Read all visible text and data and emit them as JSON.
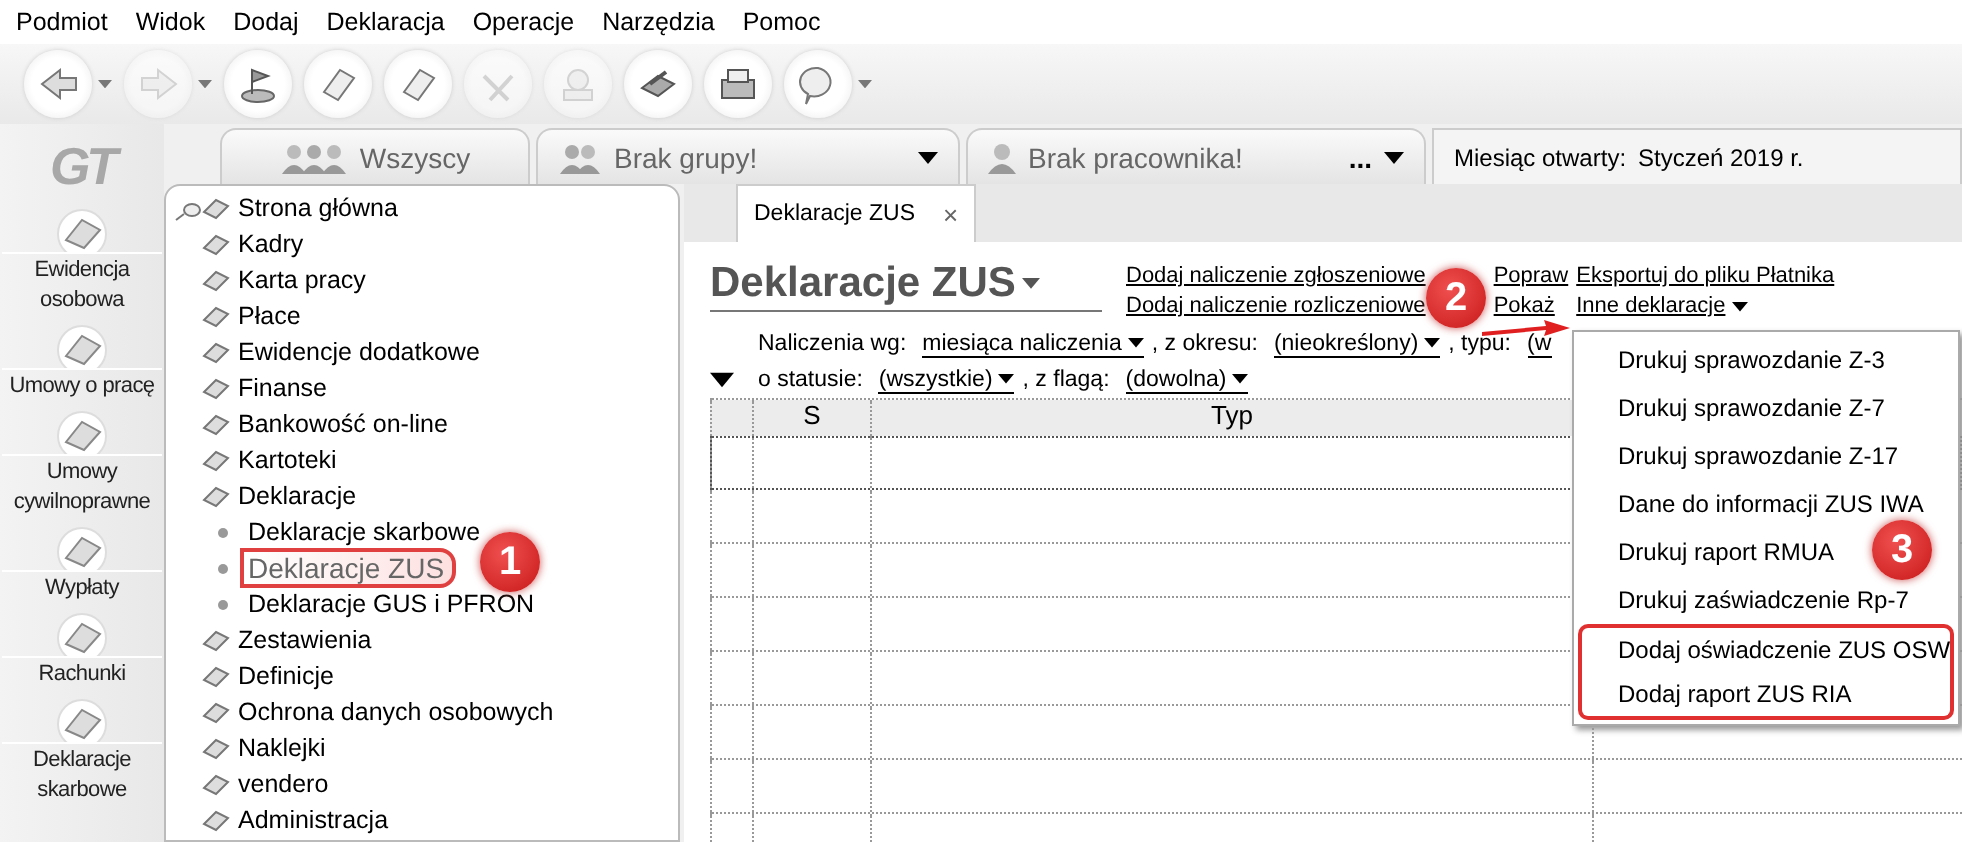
{
  "menu_bar": [
    "Podmiot",
    "Widok",
    "Dodaj",
    "Deklaracja",
    "Operacje",
    "Narzędzia",
    "Pomoc"
  ],
  "toolbar": [
    {
      "dropdown": true,
      "disabled": false
    },
    {
      "dropdown": true,
      "disabled": true
    },
    {
      "dropdown": false,
      "disabled": false
    },
    {
      "dropdown": false,
      "disabled": false
    },
    {
      "dropdown": false,
      "disabled": false
    },
    {
      "dropdown": false,
      "disabled": true
    },
    {
      "dropdown": false,
      "disabled": true
    },
    {
      "dropdown": false,
      "disabled": false
    },
    {
      "dropdown": false,
      "disabled": false
    },
    {
      "dropdown": true,
      "disabled": false
    }
  ],
  "logo": "GT",
  "nav": [
    {
      "label": "Ewidencja osobowa"
    },
    {
      "label": "Umowy o pracę"
    },
    {
      "label": "Umowy cywilnoprawne"
    },
    {
      "label": "Wypłaty"
    },
    {
      "label": "Rachunki"
    },
    {
      "label": "Deklaracje skarbowe"
    }
  ],
  "selectors": [
    {
      "label": "Wszyscy",
      "kind": "tab"
    },
    {
      "label": "Brak grupy!",
      "kind": "dropdown"
    },
    {
      "label": "Brak pracownika!",
      "kind": "employee",
      "more": "..."
    },
    {
      "label": "Miesiąc otwarty:",
      "value": "Styczeń 2019 r.",
      "kind": "info"
    }
  ],
  "tree": [
    {
      "label": "Strona główna",
      "selected": false
    },
    {
      "label": "Kadry",
      "selected": false
    },
    {
      "label": "Karta pracy",
      "selected": false
    },
    {
      "label": "Płace",
      "selected": false
    },
    {
      "label": "Ewidencje dodatkowe",
      "selected": false
    },
    {
      "label": "Finanse",
      "selected": false
    },
    {
      "label": "Bankowość on-line",
      "selected": false
    },
    {
      "label": "Kartoteki",
      "selected": false
    },
    {
      "label": "Deklaracje",
      "selected": false,
      "children": [
        {
          "label": "Deklaracje skarbowe",
          "selected": false
        },
        {
          "label": "Deklaracje ZUS",
          "selected": true
        },
        {
          "label": "Deklaracje GUS i PFRON",
          "selected": false
        }
      ]
    },
    {
      "label": "Zestawienia",
      "selected": false
    },
    {
      "label": "Definicje",
      "selected": false
    },
    {
      "label": "Ochrona danych osobowych",
      "selected": false
    },
    {
      "label": "Naklejki",
      "selected": false
    },
    {
      "label": "vendero",
      "selected": false
    },
    {
      "label": "Administracja",
      "selected": false
    }
  ],
  "document_tab": {
    "label": "Deklaracje ZUS",
    "close": "×"
  },
  "page": {
    "title": "Deklaracje ZUS",
    "links": [
      [
        "Dodaj naliczenie zgłoszeniowe",
        "Dodaj naliczenie rozliczeniowe"
      ],
      [
        "Popraw",
        "Pokaż"
      ],
      [
        "Eksportuj do pliku Płatnika",
        "Inne deklaracje"
      ]
    ],
    "filters": [
      [
        {
          "kind": "label",
          "text": "Naliczenia wg:"
        },
        {
          "kind": "dropdown",
          "text": "miesiąca naliczenia"
        },
        {
          "kind": "label",
          "text": ", z okresu:"
        },
        {
          "kind": "dropdown",
          "text": "(nieokreślony)"
        },
        {
          "kind": "label",
          "text": ", typu:"
        },
        {
          "kind": "link",
          "text": "(w"
        }
      ],
      [
        {
          "kind": "label",
          "text": "o statusie:"
        },
        {
          "kind": "dropdown",
          "text": "(wszystkie)"
        },
        {
          "kind": "label",
          "text": ", z flagą:"
        },
        {
          "kind": "dropdown",
          "text": "(dowolna)"
        }
      ]
    ],
    "table": {
      "columns": [
        "S",
        "Typ"
      ]
    }
  },
  "dropdown_menu": [
    {
      "label": "Drukuj sprawozdanie Z-3",
      "highlighted": false
    },
    {
      "label": "Drukuj sprawozdanie Z-7",
      "highlighted": false
    },
    {
      "label": "Drukuj sprawozdanie Z-17",
      "highlighted": false
    },
    {
      "label": "Dane do informacji ZUS IWA",
      "highlighted": false
    },
    {
      "label": "Drukuj raport RMUA",
      "highlighted": false
    },
    {
      "label": "Drukuj zaświadczenie Rp-7",
      "highlighted": false
    },
    {
      "label": "Dodaj oświadczenie ZUS OSW",
      "highlighted": true
    },
    {
      "label": "Dodaj raport ZUS RIA",
      "highlighted": true
    }
  ],
  "annotations": [
    {
      "label": "1"
    },
    {
      "label": "2"
    },
    {
      "label": "3"
    }
  ]
}
